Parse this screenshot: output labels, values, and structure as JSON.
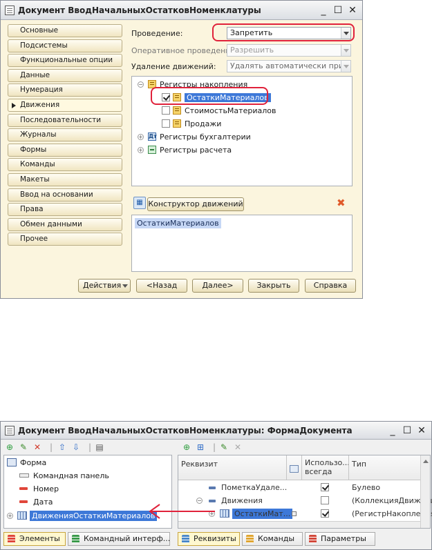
{
  "window1": {
    "title": "Документ ВводНачальныхОстатковНоменклатуры",
    "nav": [
      {
        "label": "Основные",
        "active": false
      },
      {
        "label": "Подсистемы",
        "active": false
      },
      {
        "label": "Функциональные опции",
        "active": false
      },
      {
        "label": "Данные",
        "active": false
      },
      {
        "label": "Нумерация",
        "active": false
      },
      {
        "label": "Движения",
        "active": true
      },
      {
        "label": "Последовательности",
        "active": false
      },
      {
        "label": "Журналы",
        "active": false
      },
      {
        "label": "Формы",
        "active": false
      },
      {
        "label": "Команды",
        "active": false
      },
      {
        "label": "Макеты",
        "active": false
      },
      {
        "label": "Ввод на основании",
        "active": false
      },
      {
        "label": "Права",
        "active": false
      },
      {
        "label": "Обмен данными",
        "active": false
      },
      {
        "label": "Прочее",
        "active": false
      }
    ],
    "fields": {
      "posting_label": "Проведение:",
      "posting_value": "Запретить",
      "realtime_label": "Оперативное проведение:",
      "realtime_value": "Разрешить",
      "delete_label": "Удаление движений:",
      "delete_value": "Удалять автоматически при отм"
    },
    "tree": {
      "accumulation": "Регистры накопления",
      "items": [
        {
          "label": "ОстаткиМатериалов",
          "checked": true
        },
        {
          "label": "СтоимостьМатериалов",
          "checked": false
        },
        {
          "label": "Продажи",
          "checked": false
        }
      ],
      "accounting": "Регистры бухгалтерии",
      "accounting_icon_text": "Дт",
      "calculation": "Регистры расчета"
    },
    "constructor_button": "Конструктор движений",
    "selected_register": "ОстаткиМатериалов",
    "footer": {
      "actions": "Действия",
      "back": "<Назад",
      "next": "Далее>",
      "close": "Закрыть",
      "help": "Справка"
    }
  },
  "window2": {
    "title": "Документ ВводНачальныхОстатковНоменклатуры: ФормаДокумента",
    "form_tree": {
      "root": "Форма",
      "items": [
        {
          "label": "Командная панель",
          "icon": "panel-icon"
        },
        {
          "label": "Номер",
          "icon": "field-icon"
        },
        {
          "label": "Дата",
          "icon": "field-icon"
        },
        {
          "label": "ДвиженияОстаткиМатериалов",
          "icon": "table-icon",
          "selected": true
        }
      ]
    },
    "left_tabs": [
      "Элементы",
      "Командный интерф..."
    ],
    "grid_headers": {
      "attribute": "Реквизит",
      "always": "Использо... всегда",
      "type": "Тип"
    },
    "rows": [
      {
        "name": "ПометкаУдале...",
        "checked": true,
        "type": "Булево"
      },
      {
        "name": "Движения",
        "checked": false,
        "type": "(КоллекцияДвижени"
      },
      {
        "name": "ОстаткиМат...",
        "checked": true,
        "type": "(РегистрНакопления"
      }
    ],
    "right_tabs": [
      "Реквизиты",
      "Команды",
      "Параметры"
    ]
  },
  "colors": {
    "highlight_red": "#e0213a",
    "selection_blue": "#3d78d8",
    "panel_bg": "#fbf5de"
  }
}
